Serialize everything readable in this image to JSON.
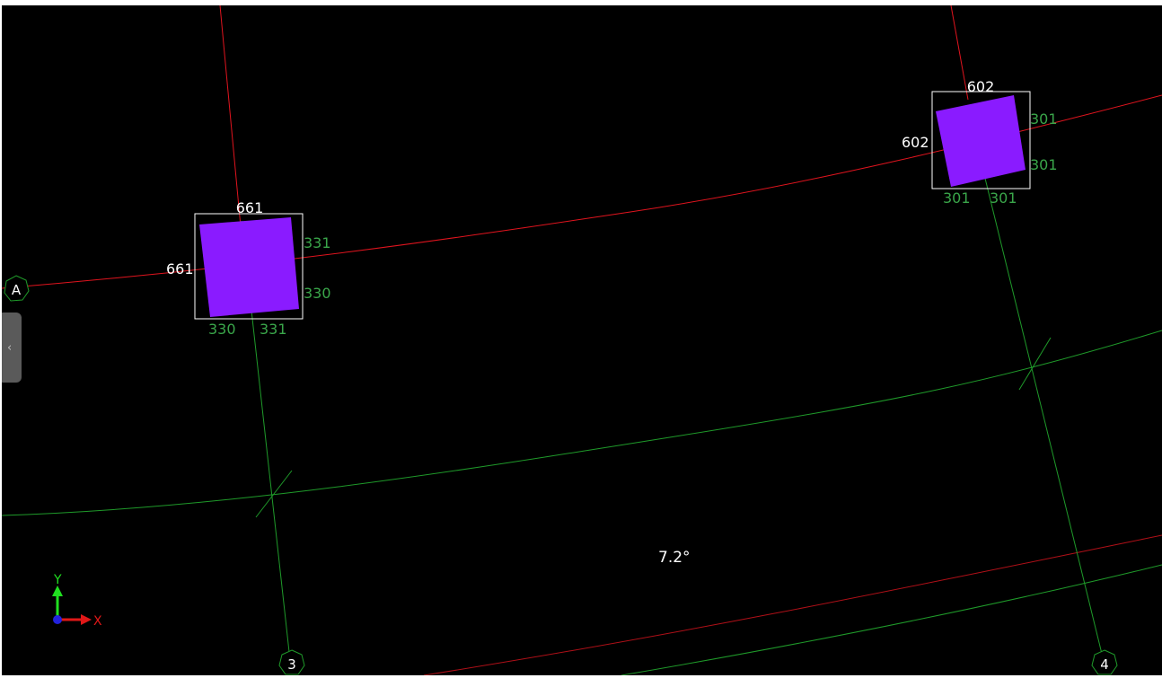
{
  "grid": {
    "axis_a": "A",
    "axis_3": "3",
    "axis_4": "4"
  },
  "columns": {
    "left": {
      "width_top": "661",
      "height_left": "661",
      "right_upper": "331",
      "right_lower": "330",
      "bottom_left": "330",
      "bottom_right": "331"
    },
    "right": {
      "width_top": "602",
      "height_left": "602",
      "right_upper": "301",
      "right_lower": "301",
      "bottom_left": "301",
      "bottom_right": "301"
    }
  },
  "angle_label": "7.2°",
  "ucs": {
    "y_label": "Y",
    "x_label": "X"
  },
  "side_panel": {
    "toggle_glyph": "‹"
  },
  "colors": {
    "background": "#000000",
    "grid_red": "#e0141e",
    "grid_green": "#1f9a2a",
    "column_fill": "#8a1bff",
    "dim_white": "#ffffff",
    "dim_green": "#3aa64a"
  }
}
